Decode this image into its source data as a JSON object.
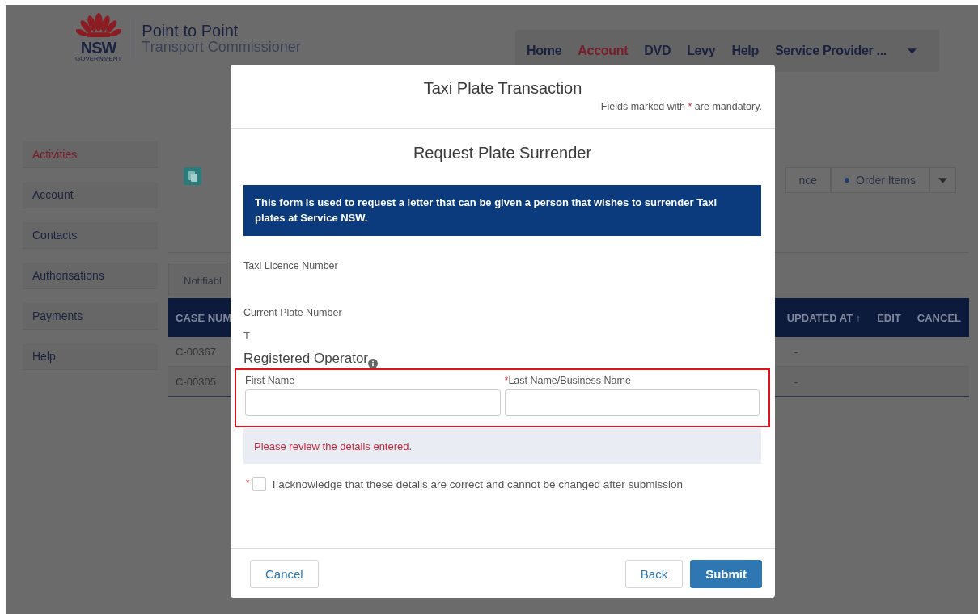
{
  "header": {
    "logo": {
      "wordmark": "NSW",
      "subtext": "GOVERNMENT",
      "title": "Point to Point",
      "subtitle": "Transport Commissioner"
    },
    "nav": [
      {
        "label": "Home",
        "selected": false
      },
      {
        "label": "Account",
        "selected": true
      },
      {
        "label": "DVD",
        "selected": false
      },
      {
        "label": "Levy",
        "selected": false
      },
      {
        "label": "Help",
        "selected": false
      },
      {
        "label": "Service Provider ...",
        "selected": false
      }
    ]
  },
  "sidebar": {
    "items": [
      {
        "label": "Activities",
        "selected": true
      },
      {
        "label": "Account",
        "selected": false
      },
      {
        "label": "Contacts",
        "selected": false
      },
      {
        "label": "Authorisations",
        "selected": false
      },
      {
        "label": "Payments",
        "selected": false
      },
      {
        "label": "Help",
        "selected": false
      }
    ]
  },
  "actions": [
    {
      "label": "nce"
    },
    {
      "label": "Order Items"
    }
  ],
  "tabs": [
    {
      "label": "Notifiabl"
    }
  ],
  "table": {
    "columns": [
      "CASE NUM",
      "UPDATED AT ↑",
      "EDIT",
      "CANCEL"
    ],
    "rows": [
      {
        "case": "C-00367",
        "updated_at": "-"
      },
      {
        "case": "C-00305",
        "updated_at": "-"
      }
    ]
  },
  "modal": {
    "title": "Taxi Plate Transaction",
    "note": {
      "before": "Fields marked with",
      "mark": "*",
      "after": "are mandatory."
    },
    "heading": "Request Plate Surrender",
    "banner": "This form is used to request a letter that can be given a person that wishes to surrender Taxi plates at Service NSW.",
    "details": [
      {
        "label": "Taxi Licence Number"
      },
      {
        "label": "Current Plate Number",
        "value": "T"
      }
    ],
    "operator": {
      "heading": "Registered Operator",
      "highlighted": true,
      "fields": [
        {
          "label": "First Name"
        },
        {
          "label": "Last Name/Business Name",
          "required_mark": "*"
        }
      ]
    },
    "error": "Please review the details entered.",
    "acknowledge": {
      "required_mark": "*",
      "checked": false,
      "label": "I acknowledge that these details are correct and cannot be changed after submission"
    },
    "buttons": [
      {
        "label": "Cancel",
        "kind": "neutral"
      },
      {
        "label": "Back",
        "kind": "neutral"
      },
      {
        "label": "Submit",
        "kind": "brand"
      }
    ]
  }
}
